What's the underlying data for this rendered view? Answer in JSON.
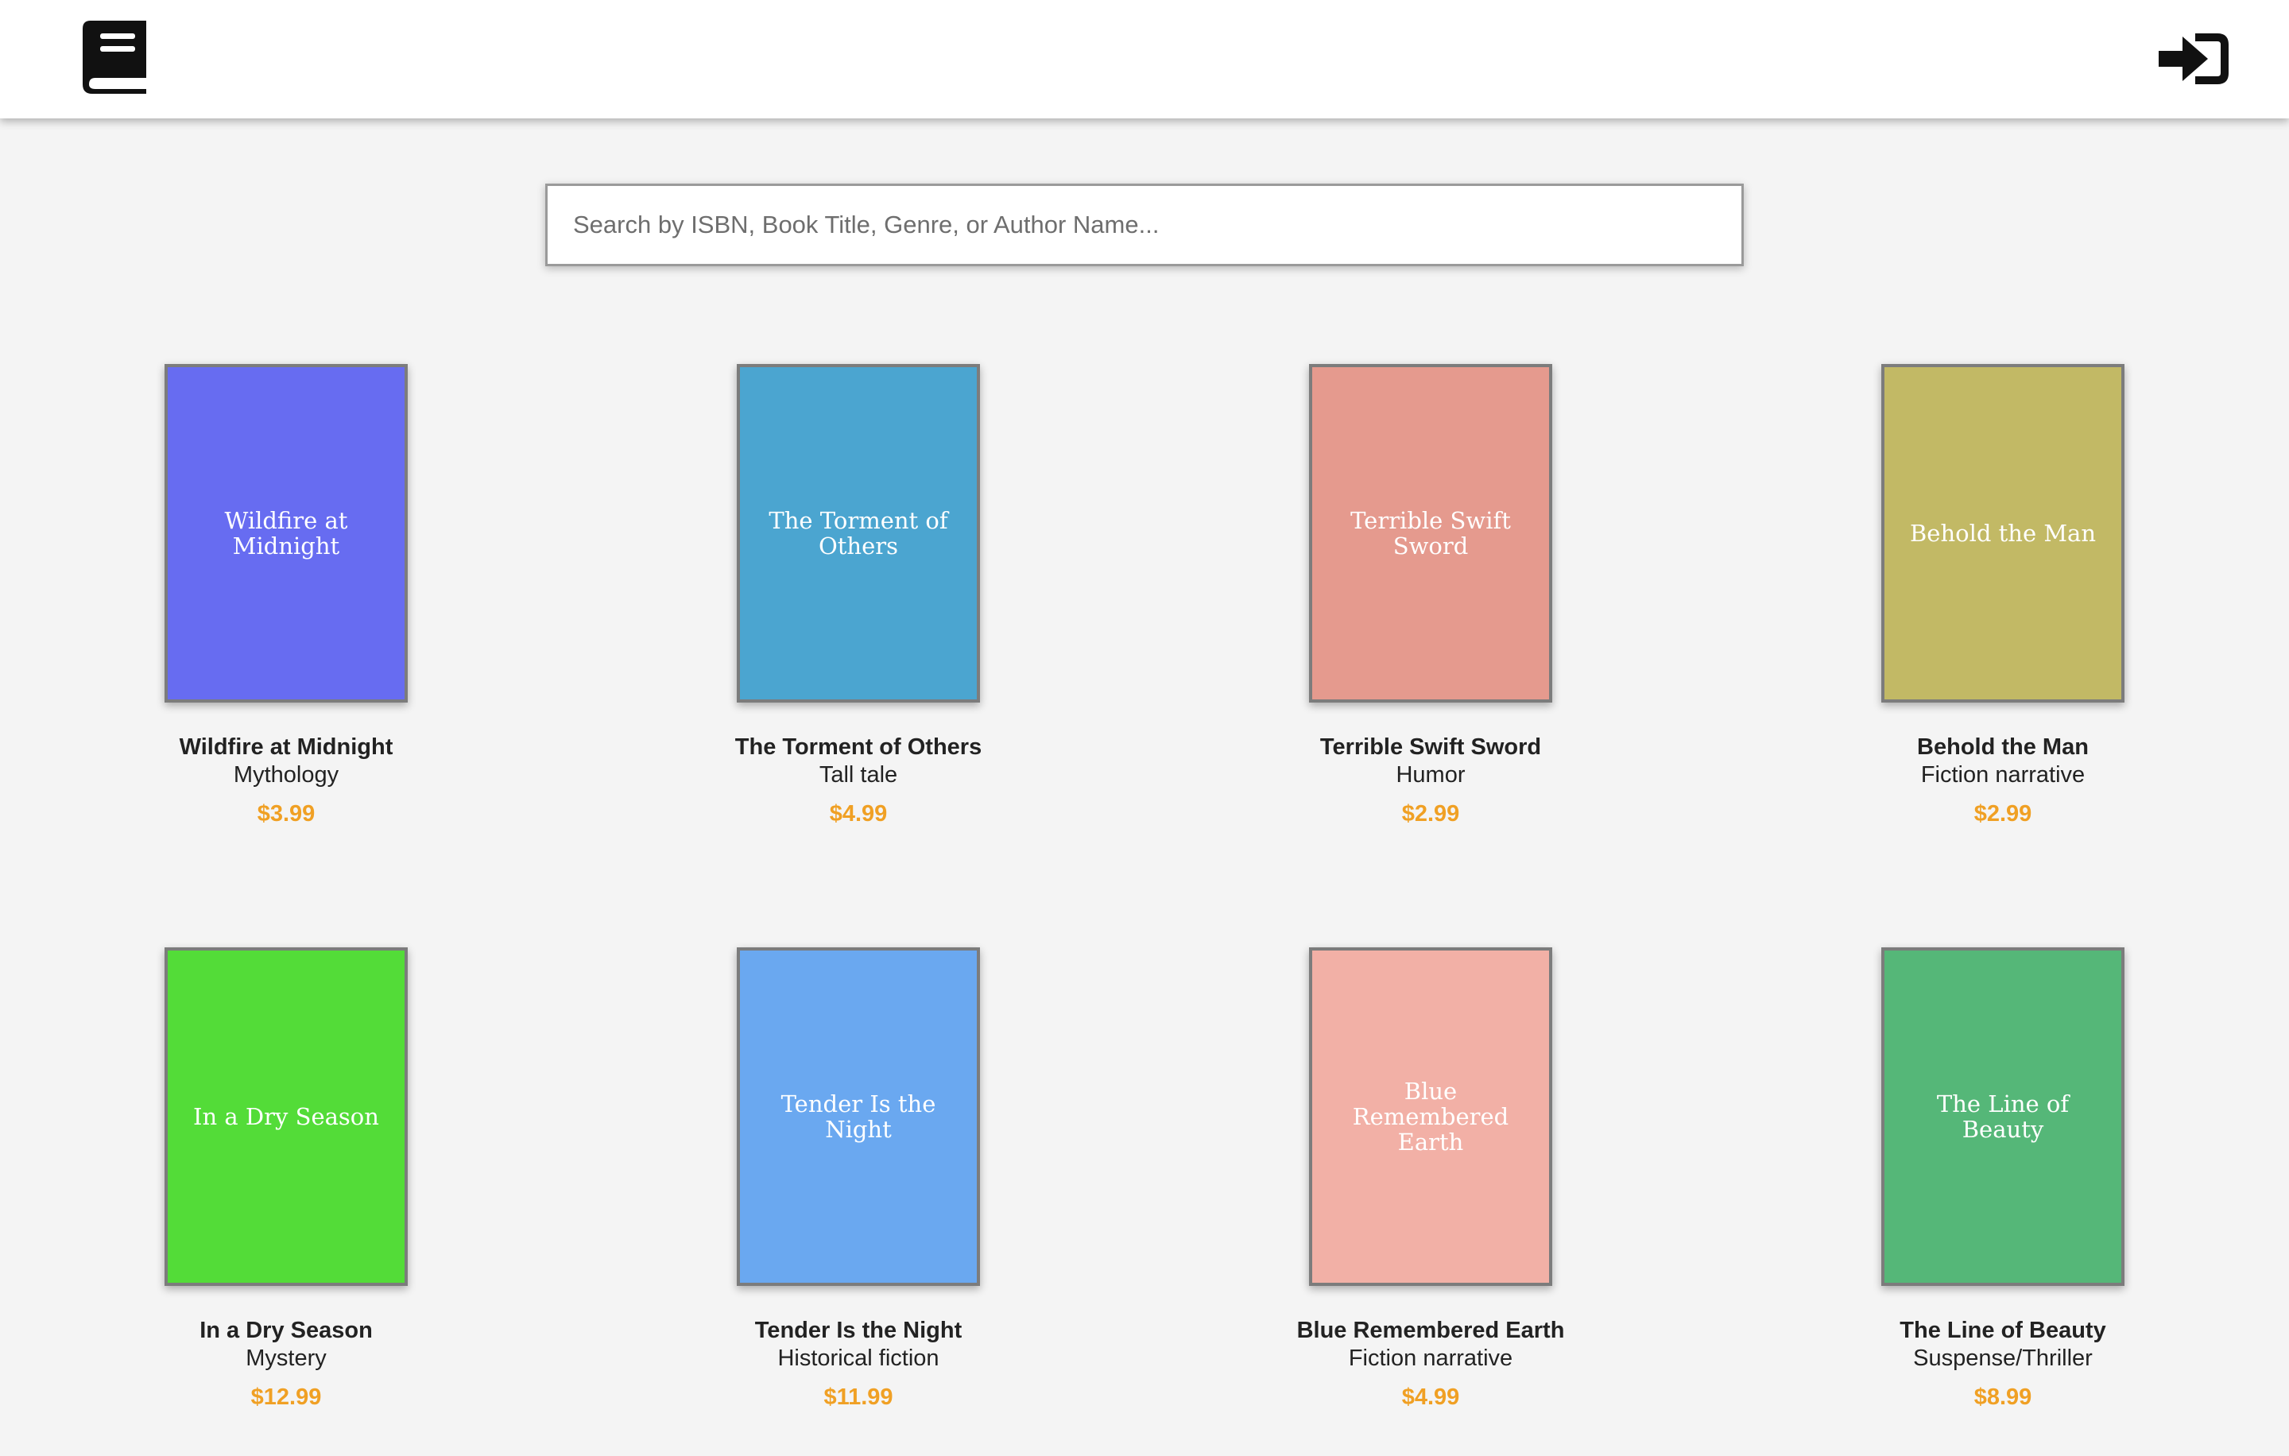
{
  "header": {
    "logo_icon": "book-icon",
    "login_icon": "sign-in-icon"
  },
  "search": {
    "placeholder": "Search by ISBN, Book Title, Genre, or Author Name...",
    "value": ""
  },
  "colors": {
    "price": "#f0a024",
    "cover_border": "#7c7c7c"
  },
  "books": [
    {
      "cover_title": "Wildfire at Midnight",
      "title": "Wildfire at Midnight",
      "genre": "Mythology",
      "price": "$3.99",
      "cover_color": "#676cf1"
    },
    {
      "cover_title": "The Torment of Others",
      "title": "The Torment of Others",
      "genre": "Tall tale",
      "price": "$4.99",
      "cover_color": "#4ba5d0"
    },
    {
      "cover_title": "Terrible Swift Sword",
      "title": "Terrible Swift Sword",
      "genre": "Humor",
      "price": "$2.99",
      "cover_color": "#e59a8e"
    },
    {
      "cover_title": "Behold the Man",
      "title": "Behold the Man",
      "genre": "Fiction narrative",
      "price": "$2.99",
      "cover_color": "#c2b965"
    },
    {
      "cover_title": "In a Dry Season",
      "title": "In a Dry Season",
      "genre": "Mystery",
      "price": "$12.99",
      "cover_color": "#53dc38"
    },
    {
      "cover_title": "Tender Is the Night",
      "title": "Tender Is the Night",
      "genre": "Historical fiction",
      "price": "$11.99",
      "cover_color": "#6aa8f0"
    },
    {
      "cover_title": "Blue Remembered Earth",
      "title": "Blue Remembered Earth",
      "genre": "Fiction narrative",
      "price": "$4.99",
      "cover_color": "#f2b0a6"
    },
    {
      "cover_title": "The Line of Beauty",
      "title": "The Line of Beauty",
      "genre": "Suspense/Thriller",
      "price": "$8.99",
      "cover_color": "#55b778"
    }
  ]
}
